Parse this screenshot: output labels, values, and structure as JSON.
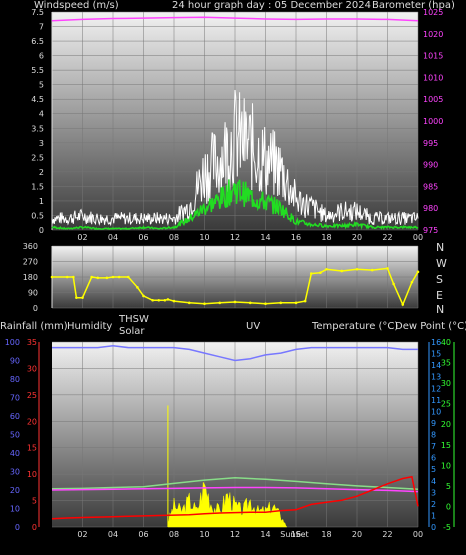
{
  "top": {
    "windspeed_label": "Windspeed (m/s)",
    "title": "24 hour graph day : 05 December 2024",
    "barometer_label": "Barometer (hpa)"
  },
  "middle": {
    "compass": [
      "N",
      "W",
      "S",
      "E",
      "N"
    ]
  },
  "bottom": {
    "rain_label": "Rainfall (mm)",
    "humidity_label": "Humidity",
    "thsw_label": "THSW",
    "solar_label": "Solar",
    "uv_label": "UV",
    "temp_label": "Temperature (°C)",
    "dew_label": "Dew Point (°C)",
    "sunset_label": "SunSet"
  },
  "colors": {
    "wind_gust": "#ffffff",
    "wind_avg": "#22dd22",
    "barometer": "#ff44ff",
    "direction": "#ffff00",
    "humidity": "#7777ff",
    "temperature": "#ff0000",
    "dewpoint": "#ff44ff",
    "thsw": "#88dd88",
    "solar": "#ffff00",
    "axis_rain": "#ff3333",
    "axis_humidity": "#6666ff",
    "axis_uv": "#3399ff",
    "axis_temp": "#33ff33"
  },
  "chart_data": [
    {
      "type": "line",
      "title": "24 hour graph day : 05 December 2024",
      "x_ticks": [
        "02",
        "04",
        "06",
        "08",
        "10",
        "12",
        "14",
        "16",
        "18",
        "20",
        "22",
        "00"
      ],
      "ylabel": "Windspeed (m/s)",
      "ylim": [
        0,
        7.5
      ],
      "y_ticks": [
        0,
        0.5,
        1,
        1.5,
        2,
        2.5,
        3,
        3.5,
        4,
        4.5,
        5,
        5.5,
        6,
        6.5,
        7,
        7.5
      ],
      "y2label": "Barometer (hpa)",
      "y2lim": [
        975,
        1025
      ],
      "y2_ticks": [
        975,
        980,
        985,
        990,
        995,
        1000,
        1005,
        1010,
        1015,
        1020,
        1025
      ],
      "series": [
        {
          "name": "Windspeed gust",
          "color": "#ffffff",
          "x": [
            0,
            1,
            2,
            3,
            4,
            5,
            6,
            7,
            8,
            9,
            10,
            11,
            12,
            13,
            14,
            15,
            16,
            17,
            18,
            19,
            20,
            21,
            22,
            23,
            24
          ],
          "y": [
            0.5,
            0.5,
            0.6,
            0.5,
            0.5,
            0.5,
            0.5,
            0.5,
            0.5,
            1.0,
            2.5,
            3.0,
            4.0,
            3.6,
            3.0,
            2.6,
            1.3,
            1.0,
            0.6,
            0.8,
            0.8,
            0.5,
            0.5,
            0.5,
            0.5
          ]
        },
        {
          "name": "Windspeed average",
          "color": "#22dd22",
          "x": [
            0,
            1,
            2,
            3,
            4,
            5,
            6,
            7,
            8,
            9,
            10,
            11,
            12,
            13,
            14,
            15,
            16,
            17,
            18,
            19,
            20,
            21,
            22,
            23,
            24
          ],
          "y": [
            0.1,
            0.05,
            0.1,
            0.05,
            0.05,
            0.05,
            0.1,
            0.05,
            0.1,
            0.4,
            0.8,
            1.1,
            1.5,
            1.2,
            1.0,
            0.8,
            0.3,
            0.2,
            0.15,
            0.15,
            0.2,
            0.1,
            0.1,
            0.1,
            0.1
          ]
        },
        {
          "name": "Barometer",
          "color": "#ff44ff",
          "axis": "y2",
          "x": [
            0,
            2,
            4,
            6,
            8,
            10,
            12,
            14,
            16,
            18,
            20,
            22,
            24
          ],
          "y": [
            1023.0,
            1023.3,
            1023.5,
            1023.6,
            1023.7,
            1023.8,
            1023.6,
            1023.4,
            1023.3,
            1023.4,
            1023.4,
            1023.3,
            1023.0
          ]
        }
      ]
    },
    {
      "type": "scatter",
      "x_ticks": [
        "02",
        "04",
        "06",
        "08",
        "10",
        "12",
        "14",
        "16",
        "18",
        "20",
        "22",
        "00"
      ],
      "ylim": [
        0,
        360
      ],
      "y_ticks": [
        0,
        90,
        180,
        270,
        360
      ],
      "series": [
        {
          "name": "Wind direction",
          "color": "#ffff00",
          "x": [
            0,
            1,
            1.4,
            1.6,
            2,
            2.6,
            3,
            3.6,
            4,
            4.4,
            5,
            5.6,
            6,
            6.6,
            7,
            7.4,
            7.6,
            8,
            9,
            10,
            11,
            12,
            13,
            14,
            15,
            16,
            16.6,
            17,
            17.6,
            18,
            19,
            20,
            21,
            22,
            22.4,
            23,
            23.6,
            24
          ],
          "y": [
            180,
            180,
            180,
            60,
            60,
            180,
            175,
            175,
            180,
            180,
            180,
            120,
            70,
            45,
            45,
            45,
            50,
            40,
            30,
            25,
            30,
            35,
            30,
            25,
            30,
            30,
            40,
            200,
            205,
            225,
            215,
            225,
            220,
            230,
            140,
            20,
            150,
            210
          ]
        }
      ]
    },
    {
      "type": "line",
      "x_ticks": [
        "02",
        "04",
        "06",
        "08",
        "10",
        "12",
        "14",
        "16",
        "18",
        "20",
        "22",
        "00"
      ],
      "ylabel": "Rainfall (mm)",
      "ylim": [
        0,
        35
      ],
      "y_ticks": [
        0,
        5,
        10,
        15,
        20,
        25,
        30,
        35
      ],
      "humidity_ticks": [
        0,
        10,
        20,
        30,
        40,
        50,
        60,
        70,
        80,
        90,
        100
      ],
      "uv_ticks": [
        0,
        1,
        2,
        3,
        4,
        5,
        6,
        7,
        8,
        9,
        10,
        11,
        12,
        13,
        14,
        15,
        16
      ],
      "y2label": "Temperature (°C)",
      "y2lim": [
        -5,
        40
      ],
      "y2_ticks": [
        -5,
        0,
        5,
        10,
        15,
        20,
        25,
        30,
        35,
        40
      ],
      "series": [
        {
          "name": "Humidity",
          "color": "#7777ff",
          "x": [
            0,
            1,
            2,
            3,
            4,
            5,
            6,
            7,
            8,
            9,
            10,
            11,
            12,
            13,
            14,
            15,
            16,
            17,
            18,
            19,
            20,
            21,
            22,
            23,
            24
          ],
          "y": [
            97,
            97,
            97,
            97,
            98,
            97,
            97,
            97,
            97,
            96,
            94,
            92,
            90,
            91,
            93,
            94,
            96,
            97,
            97,
            97,
            97,
            97,
            97,
            96,
            96
          ]
        },
        {
          "name": "Temperature",
          "color": "#ff0000",
          "x": [
            0,
            1,
            2,
            3,
            4,
            5,
            6,
            7,
            8,
            9,
            10,
            11,
            12,
            13,
            14,
            15,
            16,
            17,
            18,
            19,
            20,
            21,
            22,
            23,
            23.6,
            24
          ],
          "y": [
            -3,
            -2.8,
            -2.7,
            -2.6,
            -2.5,
            -2.4,
            -2.3,
            -2.2,
            -2.1,
            -2.0,
            -1.8,
            -1.6,
            -1.5,
            -1.4,
            -1.4,
            -1.0,
            -0.8,
            0.5,
            1.0,
            1.5,
            2.5,
            4.0,
            5.5,
            6.8,
            7.2,
            0
          ]
        },
        {
          "name": "Dew Point",
          "color": "#ff44ff",
          "x": [
            0,
            2,
            4,
            6,
            8,
            10,
            12,
            14,
            16,
            18,
            20,
            22,
            24
          ],
          "y": [
            4.0,
            4.1,
            4.2,
            4.3,
            4.4,
            4.5,
            4.6,
            4.6,
            4.5,
            4.3,
            4.1,
            3.9,
            3.6
          ]
        },
        {
          "name": "THSW",
          "color": "#88dd88",
          "x": [
            0,
            2,
            4,
            6,
            8,
            10,
            12,
            14,
            16,
            18,
            20,
            22,
            24
          ],
          "y": [
            4.3,
            4.4,
            4.6,
            4.8,
            5.6,
            6.4,
            7.0,
            6.6,
            6.1,
            5.5,
            5.0,
            4.6,
            4.2
          ]
        },
        {
          "name": "Solar",
          "color": "#ffff00",
          "type": "area",
          "x": [
            7.6,
            8,
            8.5,
            9,
            9.5,
            10,
            10.5,
            11,
            11.5,
            12,
            12.5,
            13,
            13.5,
            14,
            14.5,
            15,
            15.4
          ],
          "y": [
            1,
            4,
            3,
            5,
            3,
            8,
            4,
            3,
            6,
            4,
            3,
            5,
            3,
            3,
            4,
            2,
            0
          ]
        }
      ]
    }
  ]
}
